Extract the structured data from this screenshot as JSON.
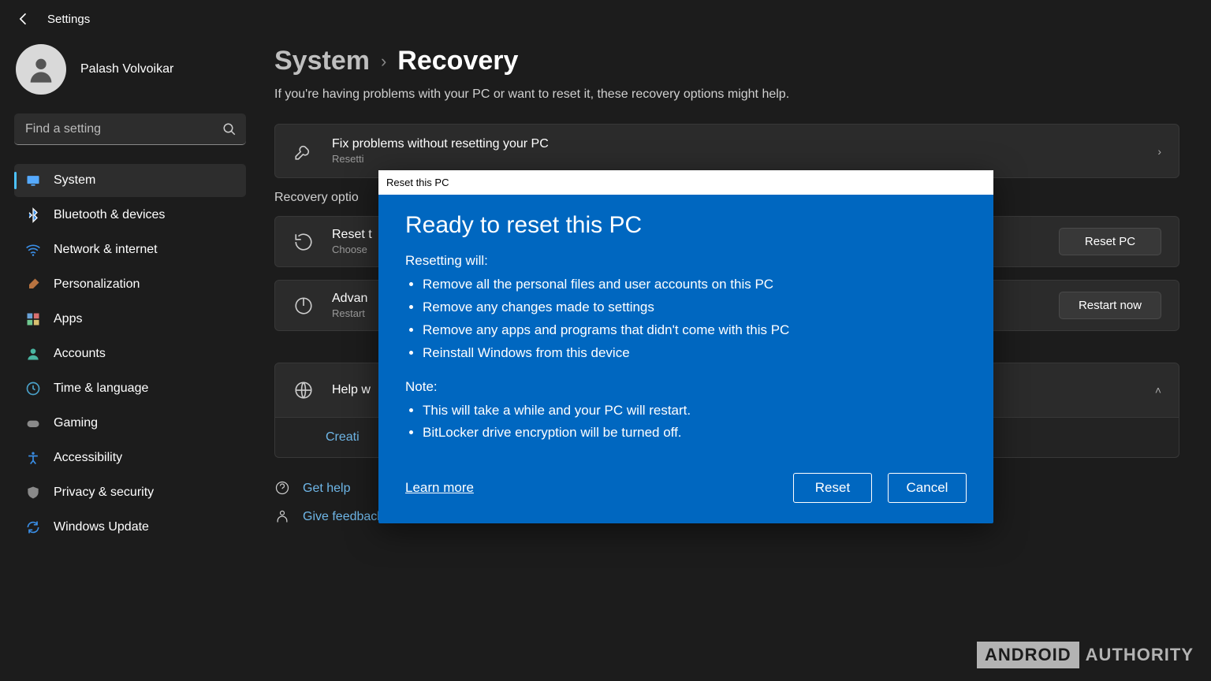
{
  "header": {
    "title": "Settings"
  },
  "profile": {
    "name": "Palash Volvoikar"
  },
  "search": {
    "placeholder": "Find a setting"
  },
  "nav": {
    "items": [
      {
        "label": "System",
        "icon": "system",
        "selected": true
      },
      {
        "label": "Bluetooth & devices",
        "icon": "bluetooth"
      },
      {
        "label": "Network & internet",
        "icon": "wifi"
      },
      {
        "label": "Personalization",
        "icon": "brush"
      },
      {
        "label": "Apps",
        "icon": "apps"
      },
      {
        "label": "Accounts",
        "icon": "person"
      },
      {
        "label": "Time & language",
        "icon": "clock"
      },
      {
        "label": "Gaming",
        "icon": "gamepad"
      },
      {
        "label": "Accessibility",
        "icon": "accessibility"
      },
      {
        "label": "Privacy & security",
        "icon": "shield"
      },
      {
        "label": "Windows Update",
        "icon": "update"
      }
    ]
  },
  "breadcrumb": {
    "parent": "System",
    "current": "Recovery"
  },
  "subtitle": "If you're having problems with your PC or want to reset it, these recovery options might help.",
  "cards": {
    "fix": {
      "title": "Fix problems without resetting your PC",
      "sub": "Resetti"
    },
    "reset": {
      "title": "Reset t",
      "sub": "Choose",
      "action": "Reset PC"
    },
    "advan": {
      "title": "Advan",
      "sub": "Restart",
      "action": "Restart now"
    },
    "help": {
      "title": "Help w",
      "link": "Creati"
    }
  },
  "section_head": "Recovery optio",
  "footer": {
    "get_help": "Get help",
    "feedback": "Give feedback"
  },
  "dialog": {
    "titlebar": "Reset this PC",
    "heading": "Ready to reset this PC",
    "resetting_label": "Resetting will:",
    "reset_items": [
      "Remove all the personal files and user accounts on this PC",
      "Remove any changes made to settings",
      "Remove any apps and programs that didn't come with this PC",
      "Reinstall Windows from this device"
    ],
    "note_label": "Note:",
    "note_items": [
      "This will take a while and your PC will restart.",
      "BitLocker drive encryption will be turned off."
    ],
    "learn_more": "Learn more",
    "reset_btn": "Reset",
    "cancel_btn": "Cancel"
  },
  "watermark": {
    "box": "ANDROID",
    "text": "AUTHORITY"
  },
  "icon_colors": {
    "system": "#55aaff",
    "bluetooth": "#3a8ee6",
    "wifi": "#3a8ee6",
    "brush": "#b87340",
    "apps": "#6aa2d8",
    "person": "#4ab5a1",
    "clock": "#4aa0c8",
    "gamepad": "#8a8a8a",
    "accessibility": "#3a8ee6",
    "shield": "#8a8a8a",
    "update": "#3a8ee6"
  }
}
